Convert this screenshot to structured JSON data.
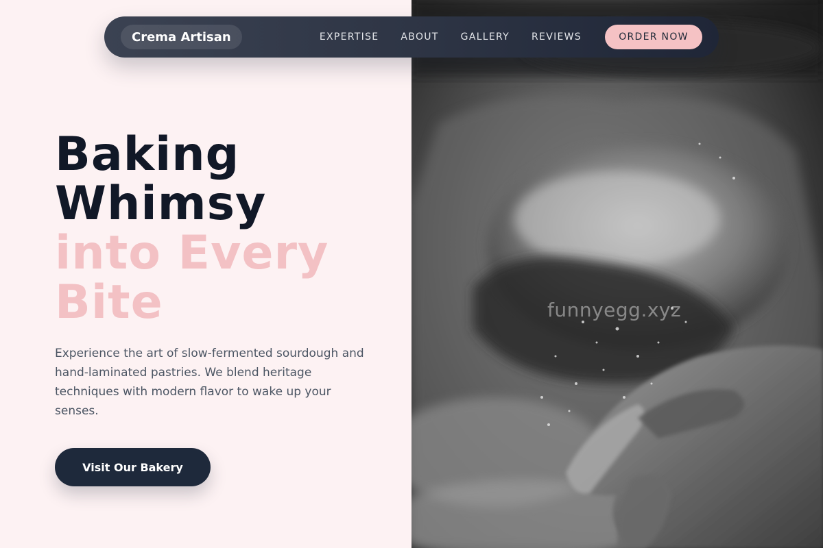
{
  "nav": {
    "brand": "Crema Artisan",
    "links": [
      "EXPERTISE",
      "ABOUT",
      "GALLERY",
      "REVIEWS"
    ],
    "cta_label": "ORDER NOW"
  },
  "hero": {
    "headline_dark": [
      "Baking",
      "Whimsy"
    ],
    "headline_accent": [
      "into Every",
      "Bite"
    ],
    "description": "Experience the art of slow-fermented sourdough and hand-laminated pastries. We blend heritage techniques with modern flavor to wake up your senses.",
    "cta_label": "Visit Our Bakery"
  },
  "photo": {
    "watermark": "funnyegg.xyz"
  },
  "colors": {
    "background": "#fdf2f3",
    "navbar": "#2e3545",
    "accent_pink": "#f3c1c4",
    "dark_text": "#111827",
    "cta": "#1e293b"
  }
}
